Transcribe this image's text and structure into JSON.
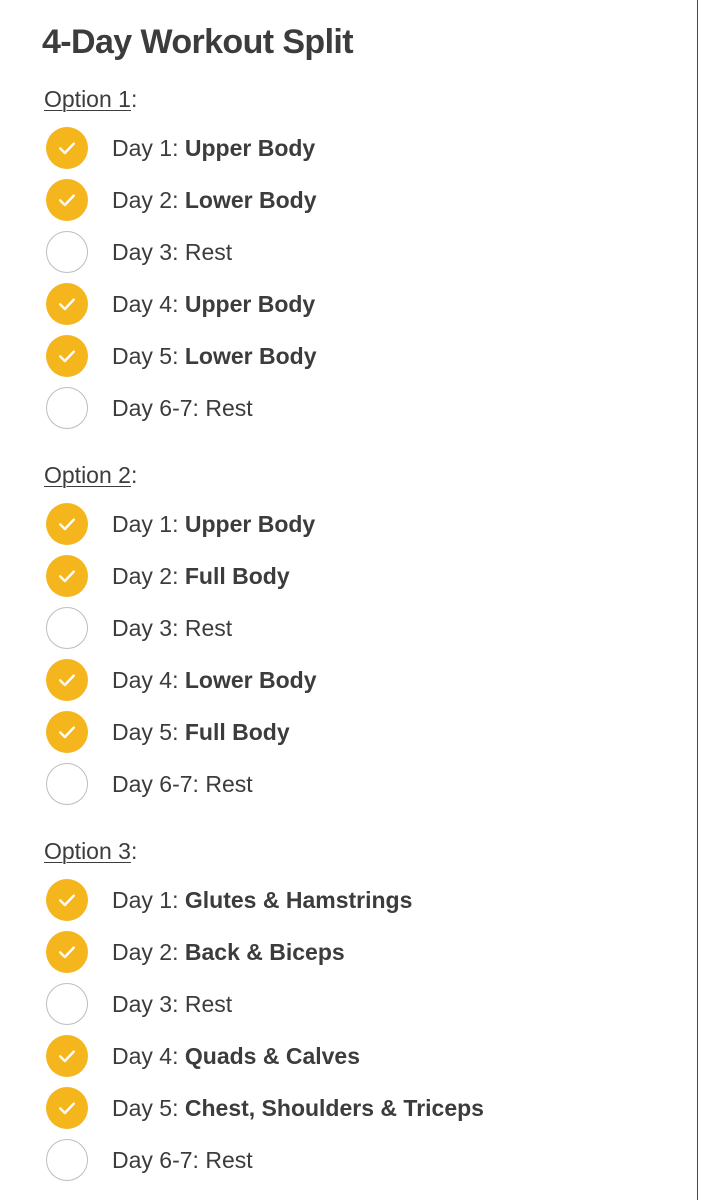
{
  "document": {
    "title": "4-Day Workout Split",
    "title_color": "#3c3c3c",
    "background_color": "#ffffff",
    "accent_color": "#F5B51C",
    "unchecked_border_color": "#bdbdbd",
    "right_rule_color": "#4a4a4a"
  },
  "icons": {
    "check": "check-icon"
  },
  "options": [
    {
      "header_label": "Option 1",
      "header_colon": ":",
      "rows": [
        {
          "prefix": "Day 1: ",
          "focus": "Upper Body",
          "checked": true,
          "bold_focus": true
        },
        {
          "prefix": "Day 2: ",
          "focus": "Lower Body",
          "checked": true,
          "bold_focus": true
        },
        {
          "prefix": "Day 3: ",
          "focus": "Rest",
          "checked": false,
          "bold_focus": false
        },
        {
          "prefix": "Day 4: ",
          "focus": "Upper Body",
          "checked": true,
          "bold_focus": true
        },
        {
          "prefix": "Day 5: ",
          "focus": "Lower Body",
          "checked": true,
          "bold_focus": true
        },
        {
          "prefix": "Day 6-7: ",
          "focus": "Rest",
          "checked": false,
          "bold_focus": false
        }
      ]
    },
    {
      "header_label": "Option 2",
      "header_colon": ":",
      "rows": [
        {
          "prefix": "Day 1: ",
          "focus": "Upper Body",
          "checked": true,
          "bold_focus": true
        },
        {
          "prefix": "Day 2: ",
          "focus": "Full Body",
          "checked": true,
          "bold_focus": true
        },
        {
          "prefix": "Day 3: ",
          "focus": "Rest",
          "checked": false,
          "bold_focus": false
        },
        {
          "prefix": "Day 4: ",
          "focus": "Lower Body",
          "checked": true,
          "bold_focus": true
        },
        {
          "prefix": "Day 5: ",
          "focus": "Full Body",
          "checked": true,
          "bold_focus": true
        },
        {
          "prefix": "Day 6-7: ",
          "focus": "Rest",
          "checked": false,
          "bold_focus": false
        }
      ]
    },
    {
      "header_label": "Option 3",
      "header_colon": ":",
      "rows": [
        {
          "prefix": "Day 1: ",
          "focus": "Glutes & Hamstrings",
          "checked": true,
          "bold_focus": true
        },
        {
          "prefix": "Day 2: ",
          "focus": "Back & Biceps",
          "checked": true,
          "bold_focus": true
        },
        {
          "prefix": "Day 3: ",
          "focus": "Rest",
          "checked": false,
          "bold_focus": false
        },
        {
          "prefix": "Day 4: ",
          "focus": "Quads & Calves",
          "checked": true,
          "bold_focus": true
        },
        {
          "prefix": "Day 5: ",
          "focus": "Chest, Shoulders & Triceps",
          "checked": true,
          "bold_focus": true
        },
        {
          "prefix": "Day 6-7: ",
          "focus": "Rest",
          "checked": false,
          "bold_focus": false
        }
      ]
    }
  ]
}
